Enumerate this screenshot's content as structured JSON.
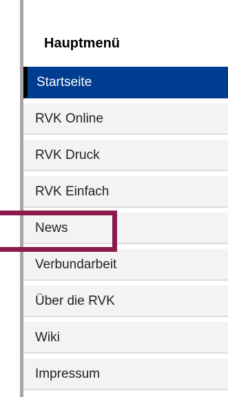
{
  "menu": {
    "title": "Hauptmenü",
    "items": [
      {
        "label": "Startseite",
        "active": true
      },
      {
        "label": "RVK Online"
      },
      {
        "label": "RVK Druck"
      },
      {
        "label": "RVK Einfach"
      },
      {
        "label": "News",
        "highlighted": true
      },
      {
        "label": "Verbundarbeit"
      },
      {
        "label": "Über die RVK"
      },
      {
        "label": "Wiki"
      },
      {
        "label": "Impressum"
      }
    ]
  },
  "colors": {
    "active_bg": "#003c8f",
    "item_bg": "#f3f3f3",
    "highlight_border": "#8b1a4d",
    "left_rule": "#a6a6a6"
  }
}
